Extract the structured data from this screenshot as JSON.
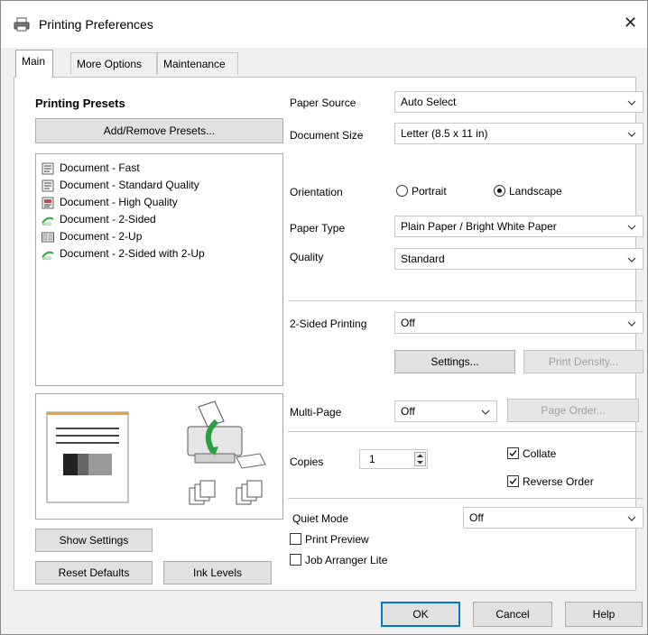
{
  "window": {
    "title": "Printing Preferences",
    "close_glyph": "✕"
  },
  "tabs": [
    {
      "label": "Main"
    },
    {
      "label": "More Options"
    },
    {
      "label": "Maintenance"
    }
  ],
  "presets": {
    "heading": "Printing Presets",
    "add_remove_label": "Add/Remove Presets...",
    "items": [
      {
        "label": "Document - Fast",
        "icon": "document-icon"
      },
      {
        "label": "Document - Standard Quality",
        "icon": "document-icon"
      },
      {
        "label": "Document - High Quality",
        "icon": "document-color-icon"
      },
      {
        "label": "Document - 2-Sided",
        "icon": "eco-icon"
      },
      {
        "label": "Document - 2-Up",
        "icon": "two-up-icon"
      },
      {
        "label": "Document - 2-Sided with 2-Up",
        "icon": "eco-icon"
      }
    ]
  },
  "settings": {
    "paper_source": {
      "label": "Paper Source",
      "value": "Auto Select"
    },
    "document_size": {
      "label": "Document Size",
      "value": "Letter (8.5 x 11 in)"
    },
    "orientation": {
      "label": "Orientation",
      "portrait": "Portrait",
      "landscape": "Landscape",
      "selected": "landscape"
    },
    "paper_type": {
      "label": "Paper Type",
      "value": "Plain Paper / Bright White Paper"
    },
    "quality": {
      "label": "Quality",
      "value": "Standard"
    },
    "two_sided": {
      "label": "2-Sided Printing",
      "value": "Off"
    },
    "settings_btn": "Settings...",
    "print_density_btn": "Print Density...",
    "multi_page": {
      "label": "Multi-Page",
      "value": "Off"
    },
    "page_order_btn": "Page Order...",
    "copies": {
      "label": "Copies",
      "value": "1"
    },
    "collate": {
      "label": "Collate",
      "checked": true
    },
    "reverse_order": {
      "label": "Reverse Order",
      "checked": true
    },
    "quiet_mode": {
      "label": "Quiet Mode",
      "value": "Off"
    },
    "print_preview": {
      "label": "Print Preview",
      "checked": false
    },
    "job_arranger": {
      "label": "Job Arranger Lite",
      "checked": false
    }
  },
  "left_buttons": {
    "show_settings": "Show Settings",
    "reset_defaults": "Reset Defaults",
    "ink_levels": "Ink Levels"
  },
  "dialog_buttons": {
    "ok": "OK",
    "cancel": "Cancel",
    "help": "Help"
  },
  "colors": {
    "accent": "#0078d7",
    "eco_green": "#3aa845",
    "preview_orange": "#f0a030"
  }
}
